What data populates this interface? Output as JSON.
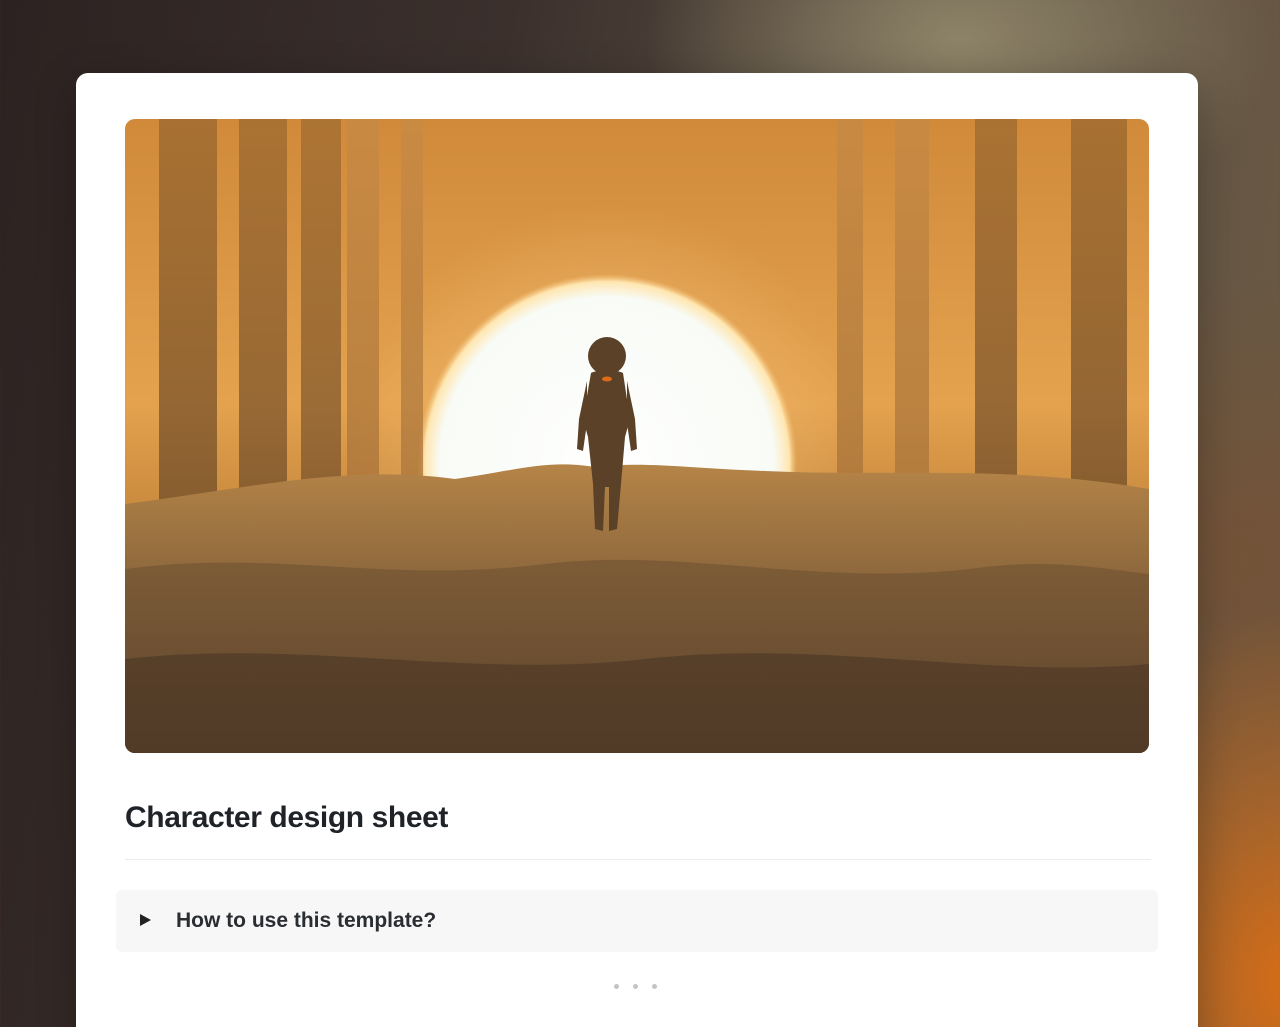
{
  "page": {
    "title": "Character design sheet",
    "cover_image": "Silhouetted astronaut standing on sand dunes in front of a glowing sun between tall columns"
  },
  "expand": {
    "label": "How to use this template?",
    "icon": "triangle-right-icon",
    "expanded": false
  },
  "more_icon": "ellipsis-icon",
  "colors": {
    "cover_top": "#d08a3a",
    "cover_bottom": "#4a3625",
    "sun": "#fbfcf7",
    "title": "#1f2328",
    "expand_bg": "#f7f7f7"
  }
}
